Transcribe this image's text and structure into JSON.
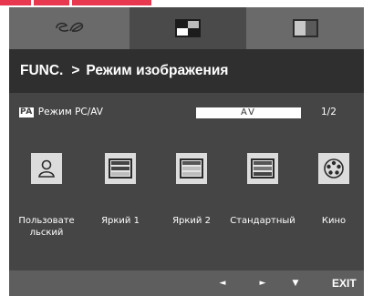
{
  "header": {
    "path_func": "FUNC.",
    "path_sep": ">",
    "path_page": "Режим изображения"
  },
  "tabs": [
    {
      "name": "eco-icon",
      "active": false
    },
    {
      "name": "picture-icon",
      "active": true
    },
    {
      "name": "split-screen-icon",
      "active": false
    }
  ],
  "setting": {
    "badge": "PA",
    "label": "Режим PC/AV",
    "value": "AV",
    "page": "1/2"
  },
  "modes": [
    {
      "label": "Пользовате\nльский",
      "icon": "user-icon"
    },
    {
      "label": "Яркий 1",
      "icon": "vivid1-icon"
    },
    {
      "label": "Яркий 2",
      "icon": "vivid2-icon"
    },
    {
      "label": "Стандартный",
      "icon": "standard-icon"
    },
    {
      "label": "Кино",
      "icon": "cinema-icon"
    }
  ],
  "footer": {
    "left_glyph": "◄",
    "right_glyph": "►",
    "down_glyph": "▼",
    "exit_label": "EXIT"
  },
  "colors": {
    "top_strip_accent": "#e8384f",
    "osd_background": "#3d3d3d",
    "header_background": "#2f2f2f",
    "tab_bar": "#6a6a6a",
    "active_tab": "#4a4a4a"
  }
}
